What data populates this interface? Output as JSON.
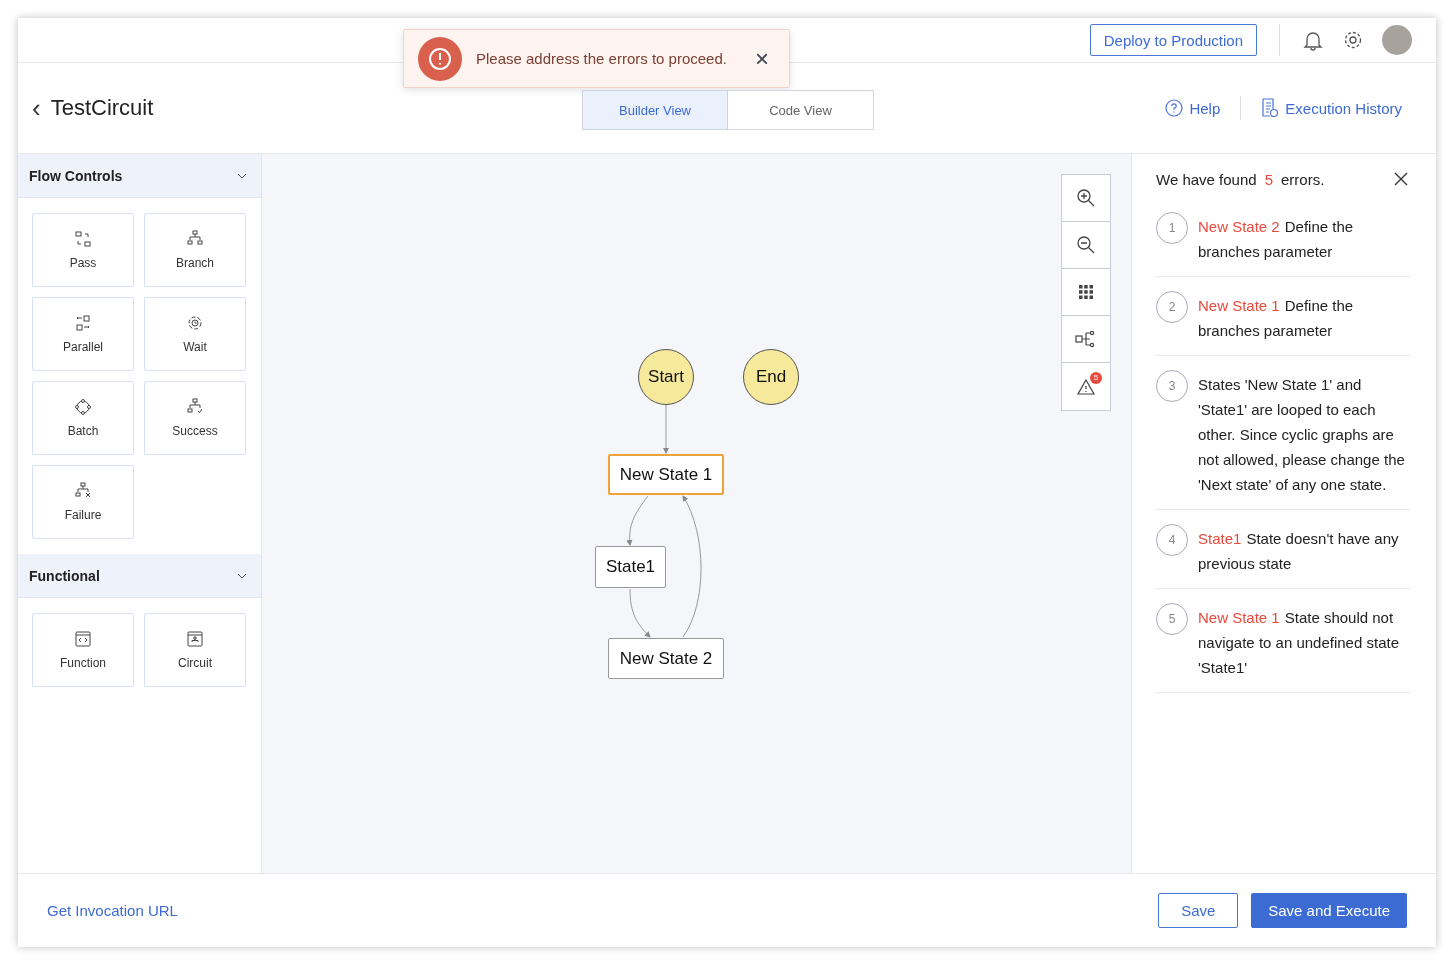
{
  "top_bar": {
    "deploy_button": "Deploy to Production"
  },
  "toast": {
    "message": "Please address the errors to proceed.",
    "close": "×"
  },
  "header": {
    "back": "‹",
    "title": "TestCircuit",
    "help": "Help",
    "history": "Execution History"
  },
  "view_tabs": [
    {
      "label": "Builder View",
      "selected": true
    },
    {
      "label": "Code View",
      "selected": false
    }
  ],
  "sidebar": {
    "sections": [
      {
        "title": "Flow Controls",
        "expanded": true,
        "items": [
          {
            "label": "Pass",
            "kind": "pass"
          },
          {
            "label": "Branch",
            "kind": "branch"
          },
          {
            "label": "Parallel",
            "kind": "parallel"
          },
          {
            "label": "Wait",
            "kind": "wait"
          },
          {
            "label": "Batch",
            "kind": "batch"
          },
          {
            "label": "Success",
            "kind": "success"
          },
          {
            "label": "Failure",
            "kind": "failure"
          }
        ]
      },
      {
        "title": "Functional",
        "expanded": true,
        "items": [
          {
            "label": "Function",
            "kind": "function"
          },
          {
            "label": "Circuit",
            "kind": "circuit"
          }
        ]
      }
    ]
  },
  "canvas": {
    "nodes": [
      {
        "label": "Start",
        "kind": "terminal",
        "selected": false
      },
      {
        "label": "End",
        "kind": "terminal",
        "selected": false
      },
      {
        "label": "New State 1",
        "kind": "state",
        "selected": true
      },
      {
        "label": "State1",
        "kind": "state",
        "selected": false
      },
      {
        "label": "New State 2",
        "kind": "state",
        "selected": false
      }
    ],
    "tools": [
      {
        "kind": "zoom-in"
      },
      {
        "kind": "zoom-out"
      },
      {
        "kind": "grid"
      },
      {
        "kind": "layout"
      },
      {
        "kind": "warnings",
        "badge": "5"
      }
    ]
  },
  "errors_panel": {
    "lead": "We have found",
    "count": "5",
    "tail": "errors.",
    "items": [
      {
        "number": "1",
        "state": "New State 2",
        "message": "Define the branches parameter"
      },
      {
        "number": "2",
        "state": "New State 1",
        "message": "Define the branches parameter"
      },
      {
        "number": "3",
        "message": "States 'New State 1' and 'State1' are looped to each other. Since cyclic graphs are not allowed, please change the 'Next state' of any one state."
      },
      {
        "number": "4",
        "state": "State1",
        "message": "State doesn't have any previous state"
      },
      {
        "number": "5",
        "state": "New State 1",
        "message": "State should not navigate to an undefined state 'State1'"
      }
    ]
  },
  "footer": {
    "link": "Get Invocation URL",
    "save": "Save",
    "save_execute": "Save and Execute"
  }
}
